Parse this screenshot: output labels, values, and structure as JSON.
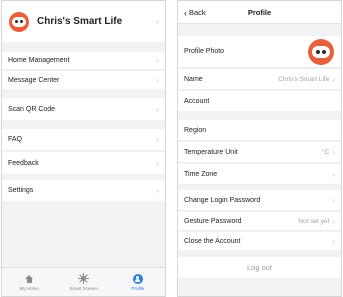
{
  "home_screen": {
    "header": {
      "name": "Chris's Smart Life",
      "avatar_icon": "robot-avatar-icon"
    },
    "menu": [
      {
        "id": "home-management",
        "label": "Home Management"
      },
      {
        "id": "message-center",
        "label": "Message Center"
      },
      {
        "id": "scan-qr-code",
        "label": "Scan QR Code"
      },
      {
        "id": "faq",
        "label": "FAQ"
      },
      {
        "id": "feedback",
        "label": "Feedback"
      },
      {
        "id": "settings",
        "label": "Settings"
      }
    ],
    "tabs": [
      {
        "label": "My Home",
        "icon": "home-icon",
        "active": false
      },
      {
        "label": "Smart Scenes",
        "icon": "sun-icon",
        "active": false
      },
      {
        "label": "Profile",
        "icon": "profile-icon",
        "active": true
      }
    ]
  },
  "profile_screen": {
    "nav": {
      "back_label": "Back",
      "title": "Profile"
    },
    "rows": {
      "profile_photo": "Profile Photo",
      "name": {
        "label": "Name",
        "value": "Chris's Smart Life"
      },
      "account": "Account",
      "region": "Region",
      "temperature_unit": {
        "label": "Temperature Unit",
        "value": "°C"
      },
      "time_zone": "Time Zone",
      "change_login_password": "Change Login Password",
      "gesture_password": {
        "label": "Gesture Password",
        "value": "Not set yet"
      },
      "close_account": "Close the Account"
    },
    "logout_label": "Log out"
  },
  "colors": {
    "accent": "#2f7de1",
    "avatar": "#e8603a",
    "background": "#f2f2f5"
  }
}
